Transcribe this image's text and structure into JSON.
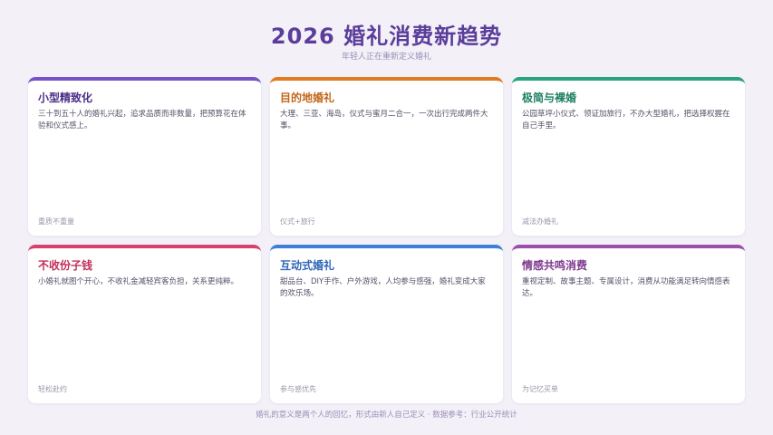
{
  "header": {
    "title": "2026 婚礼消费新趋势",
    "subtitle": "年轻人正在重新定义婚礼"
  },
  "cards": [
    {
      "title": "小型精致化",
      "desc": "三十到五十人的婚礼兴起，追求品质而非数量，把预算花在体验和仪式感上。",
      "tag": "重质不重量",
      "color": "#7a52c7",
      "title_color": "#4a2f86"
    },
    {
      "title": "目的地婚礼",
      "desc": "大理、三亚、海岛，仪式与蜜月二合一，一次出行完成两件大事。",
      "tag": "仪式+旅行",
      "color": "#e07b22",
      "title_color": "#c2661a"
    },
    {
      "title": "极简与裸婚",
      "desc": "公园草坪小仪式、领证加旅行，不办大型婚礼，把选择权握在自己手里。",
      "tag": "减法办婚礼",
      "color": "#2aa37f",
      "title_color": "#1f7f62"
    },
    {
      "title": "不收份子钱",
      "desc": "小婚礼就图个开心，不收礼金减轻宾客负担，关系更纯粹。",
      "tag": "轻松赴约",
      "color": "#d6416e",
      "title_color": "#c02f5a"
    },
    {
      "title": "互动式婚礼",
      "desc": "甜品台、DIY手作、户外游戏，人均参与感强，婚礼变成大家的欢乐场。",
      "tag": "参与感优先",
      "color": "#3f7fd6",
      "title_color": "#2f66b8"
    },
    {
      "title": "情感共鸣消费",
      "desc": "重视定制、故事主题、专属设计，消费从功能满足转向情感表达。",
      "tag": "为记忆买单",
      "color": "#9a4fa8",
      "title_color": "#7f3a8f"
    }
  ],
  "footer": {
    "text": "婚礼的意义是两个人的回忆，形式由新人自己定义 · 数据参考：行业公开统计"
  }
}
